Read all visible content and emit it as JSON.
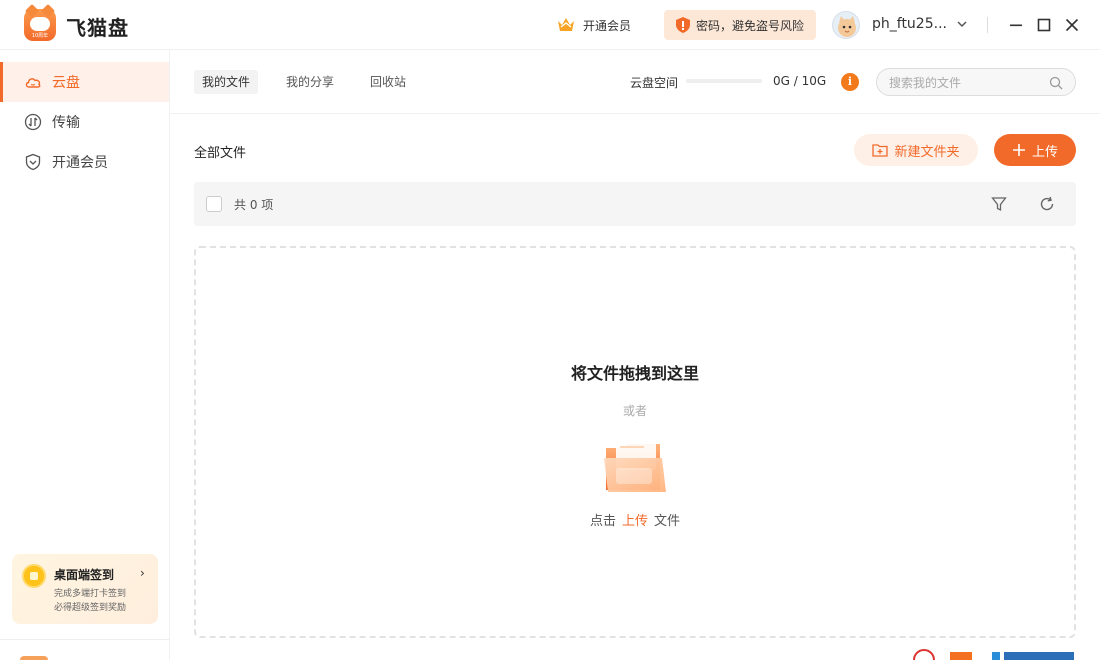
{
  "app": {
    "title": "飞猫盘",
    "logo_badge": "10周年"
  },
  "titlebar": {
    "vip_label": "开通会员",
    "security_label": "密码，避免盗号风险",
    "username": "ph_ftu25..."
  },
  "sidebar": {
    "items": [
      {
        "label": "云盘",
        "icon": "cloud-icon",
        "active": true
      },
      {
        "label": "传输",
        "icon": "transfer-icon",
        "active": false
      },
      {
        "label": "开通会员",
        "icon": "vip-shield-icon",
        "active": false
      }
    ],
    "signin": {
      "title": "桌面端签到",
      "line1": "完成多端打卡签到",
      "line2": "必得超级签到奖励"
    }
  },
  "main": {
    "tabs": [
      {
        "label": "我的文件",
        "active": true
      },
      {
        "label": "我的分享",
        "active": false
      },
      {
        "label": "回收站",
        "active": false
      }
    ],
    "quota": {
      "label": "云盘空间",
      "value": "0G / 10G",
      "used_fraction": 0
    },
    "search": {
      "placeholder": "搜索我的文件"
    },
    "breadcrumb": "全部文件",
    "new_folder_label": "新建文件夹",
    "upload_label": "上传",
    "item_count": "共 0 项",
    "dropzone": {
      "title": "将文件拖拽到这里",
      "or": "或者",
      "hint_prefix": "点击",
      "hint_link": "上传",
      "hint_suffix": "文件"
    }
  },
  "colors": {
    "accent": "#f26a2a",
    "accent_light": "#fef0e7",
    "active_nav_bg": "#fff1e9"
  }
}
